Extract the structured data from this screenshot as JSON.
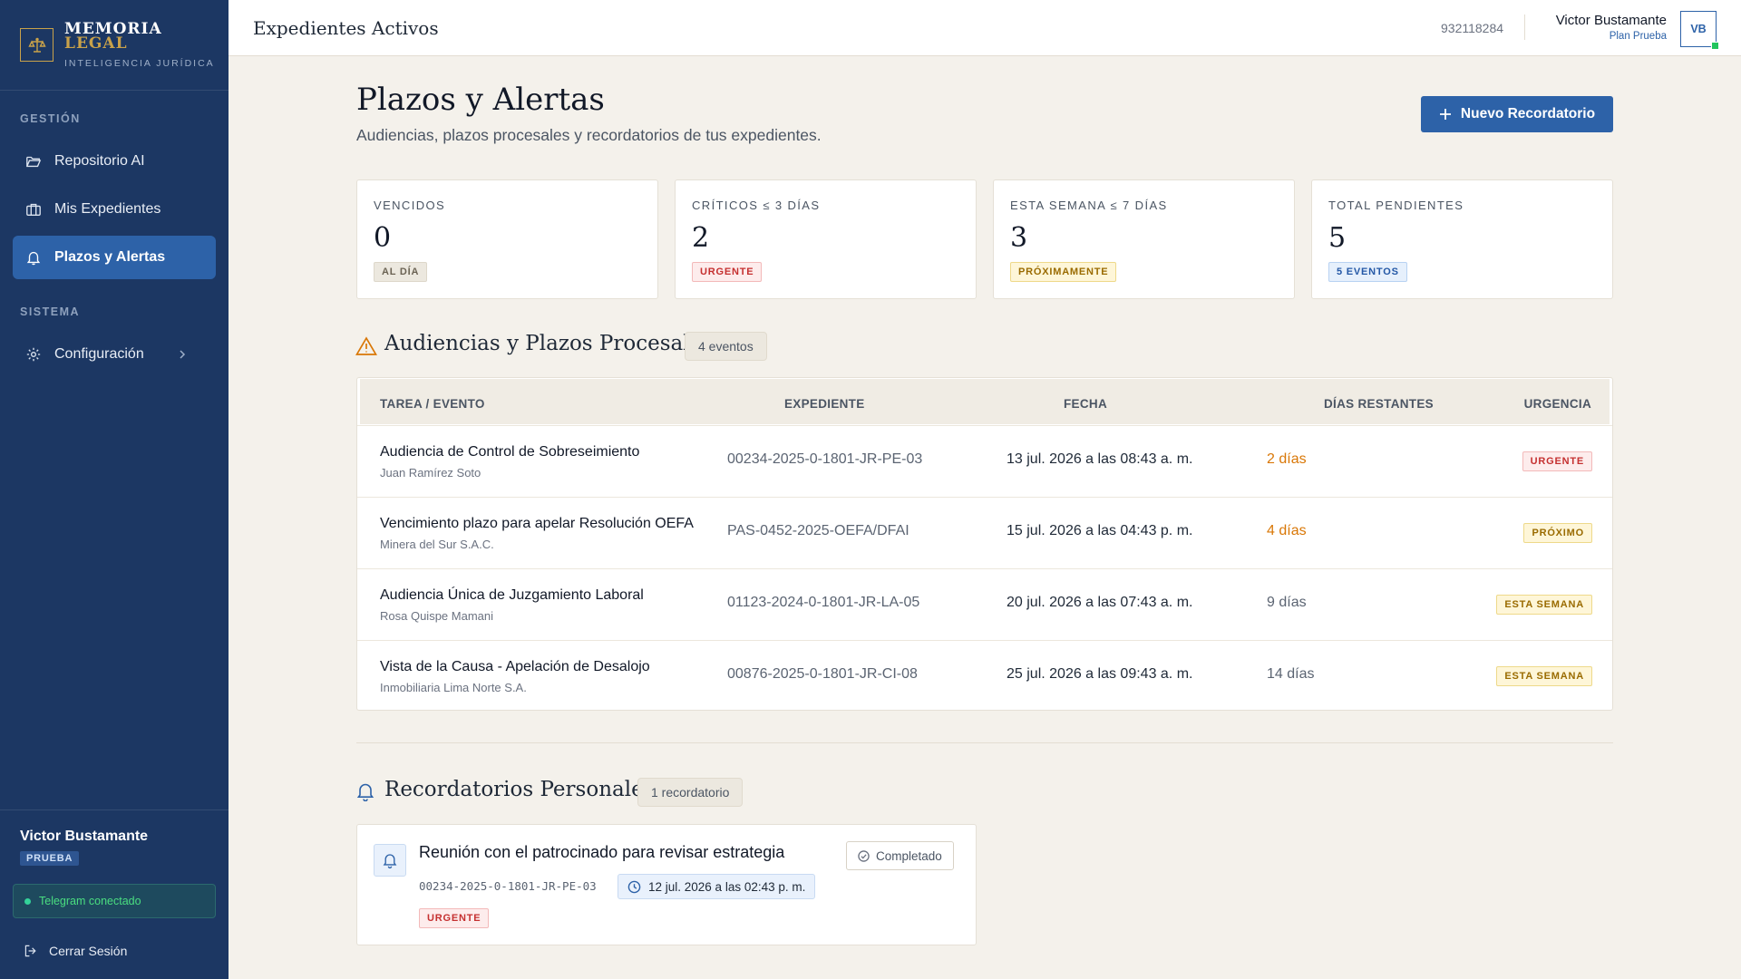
{
  "brand": {
    "line1": "MEMORIA",
    "line2": "LEGAL",
    "tagline": "INTELIGENCIA JURÍDICA"
  },
  "sidebar": {
    "sections": [
      {
        "label": "GESTIÓN"
      },
      {
        "label": "SISTEMA"
      }
    ],
    "items": [
      {
        "label": "Repositorio AI",
        "icon": "folder-open-icon"
      },
      {
        "label": "Mis Expedientes",
        "icon": "briefcase-icon"
      },
      {
        "label": "Plazos y Alertas",
        "icon": "bell-icon",
        "active": true
      },
      {
        "label": "Configuración",
        "icon": "gear-icon"
      }
    ],
    "user": {
      "name": "Victor Bustamante",
      "plan_badge": "PRUEBA"
    },
    "telegram_status": "Telegram conectado",
    "logout_label": "Cerrar Sesión"
  },
  "topbar": {
    "title": "Expedientes Activos",
    "phone": "932118284",
    "user_name": "Victor Bustamante",
    "user_plan": "Plan Prueba",
    "avatar_initials": "VB"
  },
  "page": {
    "title": "Plazos y Alertas",
    "subtitle": "Audiencias, plazos procesales y recordatorios de tus expedientes.",
    "new_button": "Nuevo Recordatorio"
  },
  "stats": [
    {
      "label": "VENCIDOS",
      "value": "0",
      "badge": "AL DÍA",
      "tone": "gray"
    },
    {
      "label": "CRÍTICOS ≤ 3 DÍAS",
      "value": "2",
      "badge": "URGENTE",
      "tone": "red"
    },
    {
      "label": "ESTA SEMANA ≤ 7 DÍAS",
      "value": "3",
      "badge": "PRÓXIMAMENTE",
      "tone": "yellow"
    },
    {
      "label": "TOTAL PENDIENTES",
      "value": "5",
      "badge": "5 EVENTOS",
      "tone": "blue"
    }
  ],
  "hearings": {
    "title": "Audiencias y Plazos Procesales",
    "count": "4 eventos",
    "columns": [
      "TAREA / EVENTO",
      "EXPEDIENTE",
      "FECHA",
      "DÍAS RESTANTES",
      "URGENCIA"
    ],
    "rows": [
      {
        "title": "Audiencia de Control de Sobreseimiento",
        "client": "Juan Ramírez Soto",
        "expediente": "00234-2025-0-1801-JR-PE-03",
        "fecha": "13 jul. 2026 a las 08:43 a. m.",
        "dias": "2 días",
        "dias_color": "#d97706",
        "urgencia": "URGENTE",
        "tone": "red"
      },
      {
        "title": "Vencimiento plazo para apelar Resolución OEFA",
        "client": "Minera del Sur S.A.C.",
        "expediente": "PAS-0452-2025-OEFA/DFAI",
        "fecha": "15 jul. 2026 a las 04:43 p. m.",
        "dias": "4 días",
        "dias_color": "#d97706",
        "urgencia": "PRÓXIMO",
        "tone": "yellow"
      },
      {
        "title": "Audiencia Única de Juzgamiento Laboral",
        "client": "Rosa Quispe Mamani",
        "expediente": "01123-2024-0-1801-JR-LA-05",
        "fecha": "20 jul. 2026 a las 07:43 a. m.",
        "dias": "9 días",
        "dias_color": "#5b6472",
        "urgencia": "ESTA SEMANA",
        "tone": "yellow"
      },
      {
        "title": "Vista de la Causa - Apelación de Desalojo",
        "client": "Inmobiliaria Lima Norte S.A.",
        "expediente": "00876-2025-0-1801-JR-CI-08",
        "fecha": "25 jul. 2026 a las 09:43 a. m.",
        "dias": "14 días",
        "dias_color": "#5b6472",
        "urgencia": "ESTA SEMANA",
        "tone": "yellow"
      }
    ]
  },
  "reminders": {
    "title": "Recordatorios Personales",
    "count": "1 recordatorio",
    "items": [
      {
        "title": "Reunión con el patrocinado para revisar estrategia",
        "expediente": "00234-2025-0-1801-JR-PE-03",
        "fecha": "12 jul. 2026 a las 02:43 p. m.",
        "badge": "URGENTE",
        "action": "Completado"
      }
    ]
  },
  "colors": {
    "sidebar": "#1c3763",
    "accent": "#2d62a8",
    "gold": "#c9a24a",
    "background": "#f4f1eb"
  }
}
